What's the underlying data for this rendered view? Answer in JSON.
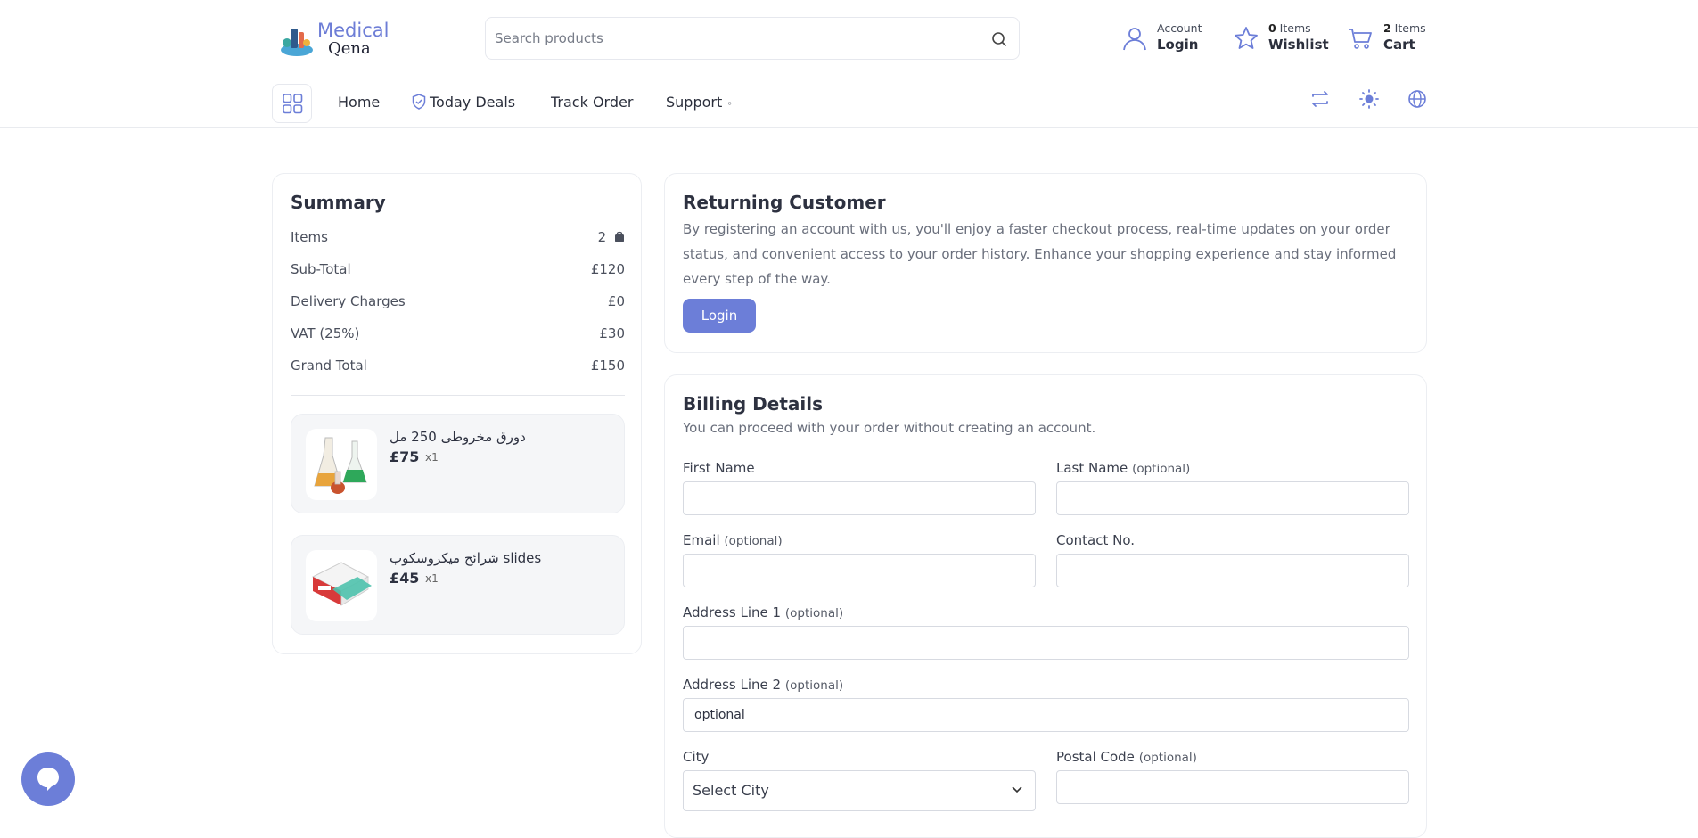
{
  "brand": {
    "line1": "Medical",
    "line2": "Qena"
  },
  "search": {
    "placeholder": "Search products"
  },
  "header": {
    "account": {
      "small": "Account",
      "big": "Login"
    },
    "wishlist": {
      "count": "0",
      "small_suffix": " Items",
      "big": "Wishlist"
    },
    "cart": {
      "count": "2",
      "small_suffix": " Items",
      "big": "Cart"
    }
  },
  "nav": {
    "home": "Home",
    "today_deals": "Today Deals",
    "track_order": "Track Order",
    "support": "Support",
    "support_indicator": "◦"
  },
  "summary": {
    "title": "Summary",
    "rows": [
      {
        "label": "Items",
        "value": "2"
      },
      {
        "label": "Sub-Total",
        "value": "£120"
      },
      {
        "label": "Delivery Charges",
        "value": "£0"
      },
      {
        "label": "VAT (25%)",
        "value": "£30"
      },
      {
        "label": "Grand Total",
        "value": "£150"
      }
    ],
    "products": [
      {
        "name": "دورق مخروطى 250 مل",
        "price": "£75",
        "qty": "x1"
      },
      {
        "name": "شرائح ميكروسكوب slides",
        "price": "£45",
        "qty": "x1"
      }
    ]
  },
  "returning": {
    "title": "Returning Customer",
    "text": "By registering an account with us, you'll enjoy a faster checkout process, real-time updates on your order status, and convenient access to your order history. Enhance your shopping experience and stay informed every step of the way.",
    "login_label": "Login"
  },
  "billing": {
    "title": "Billing Details",
    "subtitle": "You can proceed with your order without creating an account.",
    "optional_tag": "(optional)",
    "first_name": {
      "label": "First Name",
      "value": ""
    },
    "last_name": {
      "label": "Last Name",
      "value": ""
    },
    "email": {
      "label": "Email",
      "value": ""
    },
    "contact": {
      "label": "Contact No.",
      "value": ""
    },
    "address1": {
      "label": "Address Line 1",
      "value": ""
    },
    "address2": {
      "label": "Address Line 2",
      "value": "optional"
    },
    "city": {
      "label": "City",
      "selected": "Select City"
    },
    "postal": {
      "label": "Postal Code",
      "value": ""
    }
  },
  "colors": {
    "accent": "#6c7ed8",
    "border": "#eceef2"
  },
  "icons": [
    "search-icon",
    "user-icon",
    "star-icon",
    "cart-icon",
    "grid-icon",
    "shield-icon",
    "swap-icon",
    "sun-icon",
    "globe-icon",
    "bag-icon",
    "chevron-down-icon",
    "chat-icon"
  ]
}
